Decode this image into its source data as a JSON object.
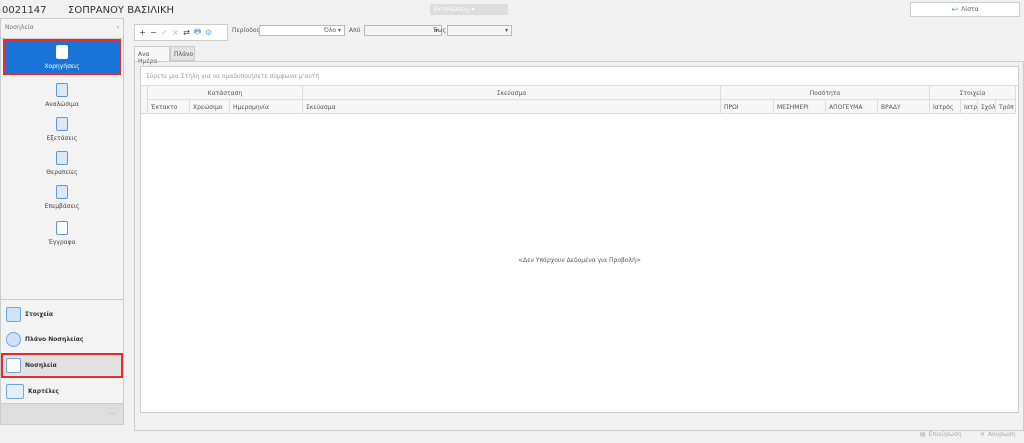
{
  "header": {
    "patient_id": "0021147",
    "patient_name": "ΣΟΠΡΑΝΟΥ ΒΑΣΙΛΙΚΗ",
    "print_label": "Εκτυπώσεις ▾",
    "list_label": "Λίστα"
  },
  "sidebar": {
    "title": "Νοσηλεία",
    "collapse": "‹",
    "items": [
      {
        "label": "Χορηγήσεις",
        "icon": "syringe-icon"
      },
      {
        "label": "Αναλώσιμα",
        "icon": "bandage-roll-icon"
      },
      {
        "label": "Εξετάσεις",
        "icon": "microscope-icon"
      },
      {
        "label": "Θεραπείες",
        "icon": "iv-bag-icon"
      },
      {
        "label": "Επεμβάσεις",
        "icon": "scalpel-icon"
      },
      {
        "label": "Έγγραφα",
        "icon": "document-icon"
      }
    ],
    "nav": [
      {
        "label": "Στοιχεία",
        "icon": "id-card-icon"
      },
      {
        "label": "Πλάνο Νοσηλείας",
        "icon": "check-circle-icon"
      },
      {
        "label": "Νοσηλεία",
        "icon": "nurse-icon"
      },
      {
        "label": "Καρτέλες",
        "icon": "folder-icon"
      }
    ],
    "footer": "···"
  },
  "toolbar": {
    "buttons": [
      "+",
      "−",
      "✓",
      "×",
      "⇄",
      "🖶",
      "⚙"
    ],
    "period_label": "Περίοδος",
    "period_value": "Όλο",
    "from_label": "Από",
    "from_value": "",
    "to_label": "Έως",
    "to_value": ""
  },
  "tabs": [
    {
      "label": "Ανα Ημέρα",
      "active": true
    },
    {
      "label": "Πλάνο",
      "active": false
    }
  ],
  "grid": {
    "group_hint": "Σύρετε μια Στήλη για να ομαδοποιήσετε σύμφωνα μ'αυτή",
    "groups": [
      "Κατάσταση",
      "Σκεύασμα",
      "Ποσότητα",
      "Στοιχεία"
    ],
    "columns": [
      "Έκτακτο",
      "Χρεώσιμο",
      "Ημερομηνία",
      "Σκεύασμα",
      "ΠΡΩΙ",
      "ΜΕΣΗΜΕΡΙ",
      "ΑΠΟΓΕΥΜΑ",
      "ΒΡΑΔΥ",
      "Ιατρός",
      "Ιατρ",
      "Σχόλ",
      "Τρόπ"
    ],
    "empty": "<Δεν Υπάρχουν Δεδομένα για Προβολή>"
  },
  "footer": {
    "confirm": "Επικύρωση",
    "cancel": "Ακύρωση"
  },
  "colors": {
    "accent": "#1874d6",
    "highlight_border": "#e52b2b"
  }
}
